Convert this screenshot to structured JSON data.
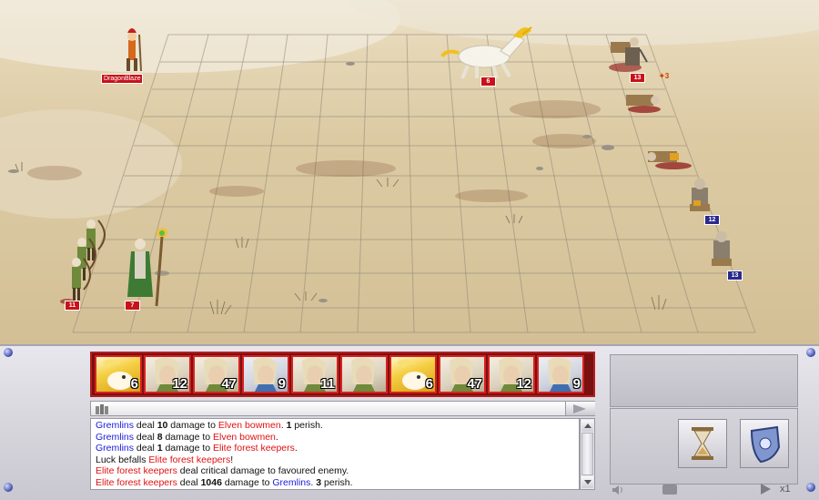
{
  "hero": {
    "name": "DragonBlaze"
  },
  "battlefield": {
    "units": [
      {
        "id": "unicorn",
        "count": "6",
        "side": "enemy"
      },
      {
        "id": "gremlin-top",
        "count": "13",
        "side": "enemy",
        "morale": "3"
      },
      {
        "id": "gremlin-mid",
        "count": "12",
        "side": "ally"
      },
      {
        "id": "gremlin-bottom",
        "count": "13",
        "side": "ally"
      },
      {
        "id": "elven-bowmen",
        "count": "11",
        "side": "enemy"
      },
      {
        "id": "druid",
        "count": "7",
        "side": "enemy"
      }
    ]
  },
  "turn_queue": [
    {
      "unit": "Unicorn",
      "count": "6",
      "style": "gold"
    },
    {
      "unit": "Elven bowmen",
      "count": "12",
      "style": "elf"
    },
    {
      "unit": "Elite forest keepers",
      "count": "47",
      "style": "elf"
    },
    {
      "unit": "Druid",
      "count": "9",
      "style": "elf2"
    },
    {
      "unit": "Elven bowmen",
      "count": "11",
      "style": "elf"
    },
    {
      "unit": "Hero",
      "count": "",
      "style": "elf"
    },
    {
      "unit": "Unicorn",
      "count": "6",
      "style": "gold"
    },
    {
      "unit": "Elite forest keepers",
      "count": "47",
      "style": "elf"
    },
    {
      "unit": "Elven bowmen",
      "count": "12",
      "style": "elf"
    },
    {
      "unit": "Druid",
      "count": "9",
      "style": "elf2"
    }
  ],
  "combat_log": [
    [
      {
        "t": "Gremlins",
        "c": "blue"
      },
      {
        "t": " deal "
      },
      {
        "t": "10",
        "b": true
      },
      {
        "t": " damage to "
      },
      {
        "t": "Elven bowmen",
        "c": "red"
      },
      {
        "t": ". "
      },
      {
        "t": "1",
        "b": true
      },
      {
        "t": " perish."
      }
    ],
    [
      {
        "t": "Gremlins",
        "c": "blue"
      },
      {
        "t": " deal "
      },
      {
        "t": "8",
        "b": true
      },
      {
        "t": " damage to "
      },
      {
        "t": "Elven bowmen",
        "c": "red"
      },
      {
        "t": "."
      }
    ],
    [
      {
        "t": "Gremlins",
        "c": "blue"
      },
      {
        "t": " deal "
      },
      {
        "t": "1",
        "b": true
      },
      {
        "t": " damage to "
      },
      {
        "t": "Elite forest keepers",
        "c": "red"
      },
      {
        "t": "."
      }
    ],
    [
      {
        "t": "Luck befalls "
      },
      {
        "t": "Elite forest keepers",
        "c": "red"
      },
      {
        "t": "!"
      }
    ],
    [
      {
        "t": "Elite forest keepers",
        "c": "red"
      },
      {
        "t": " deal critical damage to favoured enemy."
      }
    ],
    [
      {
        "t": "Elite forest keepers",
        "c": "red"
      },
      {
        "t": " deal "
      },
      {
        "t": "1046",
        "b": true
      },
      {
        "t": " damage to "
      },
      {
        "t": "Gremlins",
        "c": "blue"
      },
      {
        "t": ". "
      },
      {
        "t": "3",
        "b": true
      },
      {
        "t": " perish."
      }
    ]
  ],
  "controls": {
    "speed_label": "x1",
    "wait_icon": "hourglass-icon",
    "defend_icon": "shield-icon"
  },
  "colors": {
    "enemy": "#c8121a",
    "ally": "#2a2a8c",
    "log_enemy": "#e01010",
    "log_ally": "#1a1adc"
  }
}
